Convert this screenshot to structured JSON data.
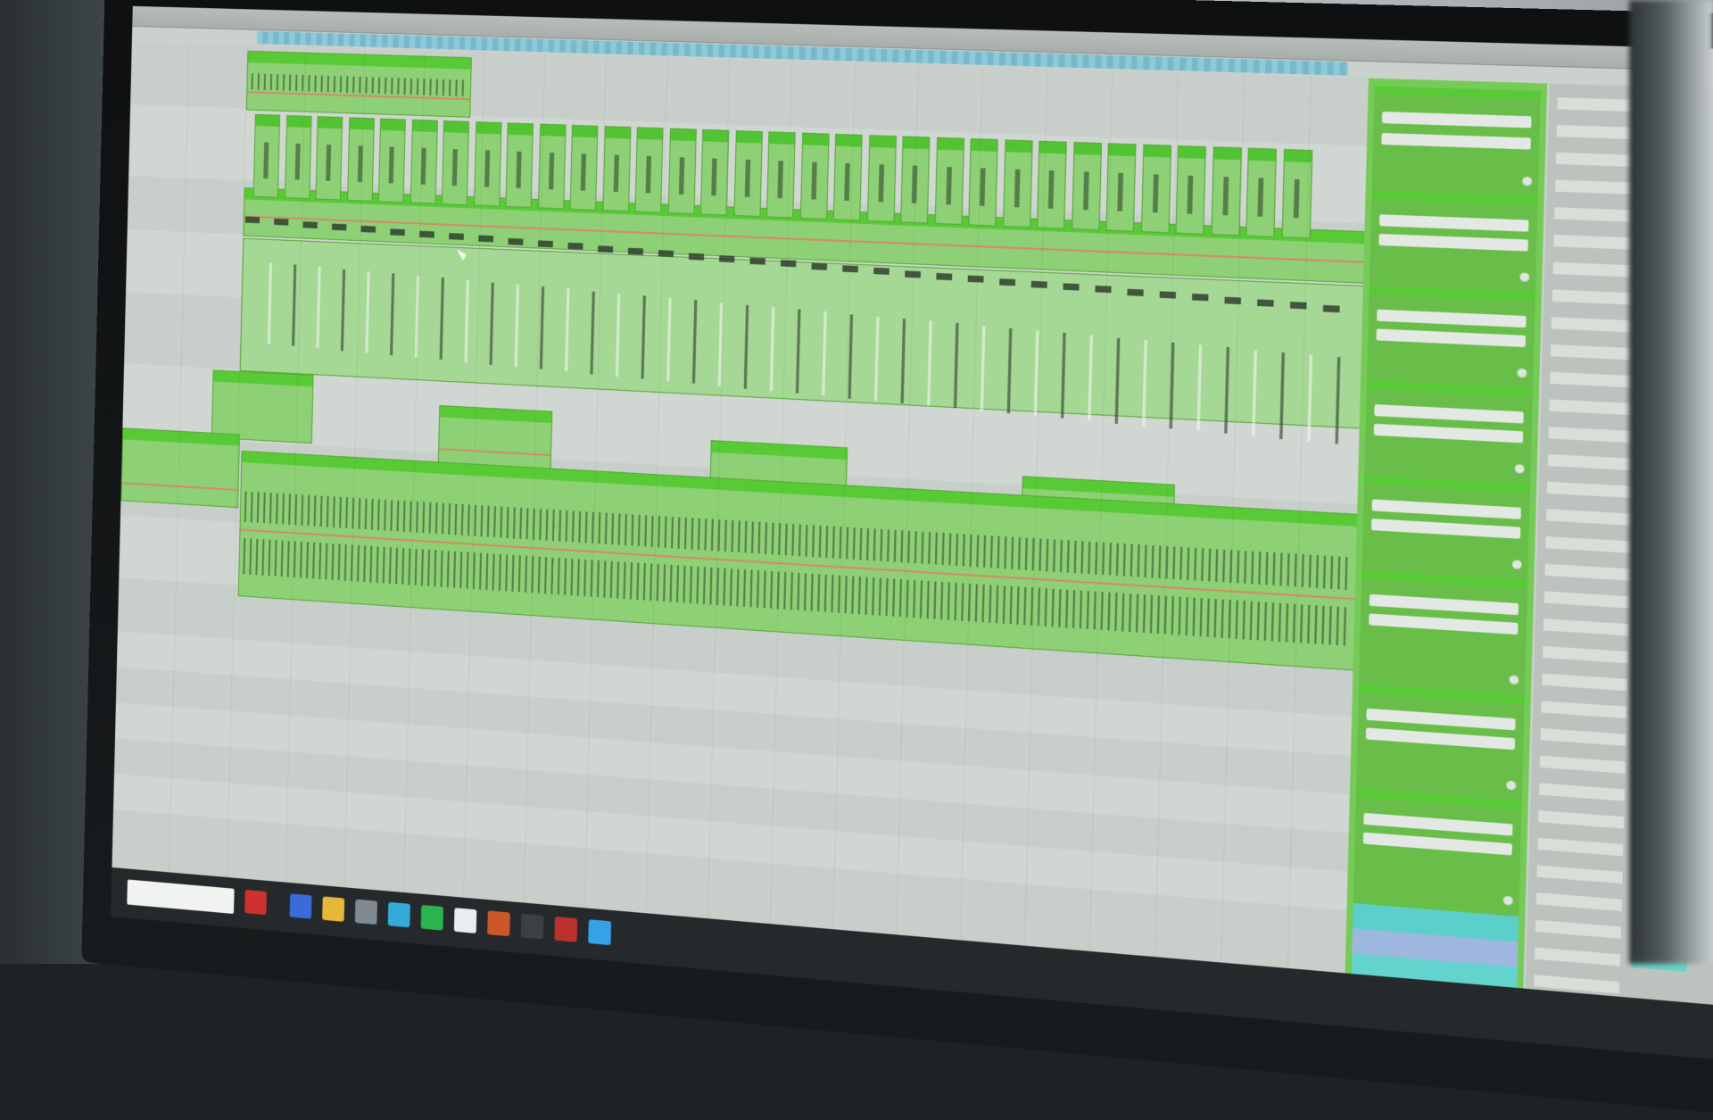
{
  "scene": {
    "description": "",
    "accent_green": "#5cc83a",
    "clip_green": "#8fcf78",
    "orange_tag": "#f2a13b",
    "cyan_tag": "#6ad2c9"
  },
  "ruler": {
    "ticks": [
      "",
      "",
      "",
      "",
      "",
      "",
      "",
      "",
      "",
      "",
      "",
      "",
      "",
      "",
      "",
      "",
      "",
      "",
      ""
    ]
  },
  "taskbar": {
    "icons": [
      "chrome-icon",
      "folder-icon",
      "files-icon",
      "app-icon",
      "spotify-icon",
      "check-icon",
      "ableton-icon",
      "live-icon",
      "red-app-icon",
      "blue-app-icon"
    ]
  }
}
